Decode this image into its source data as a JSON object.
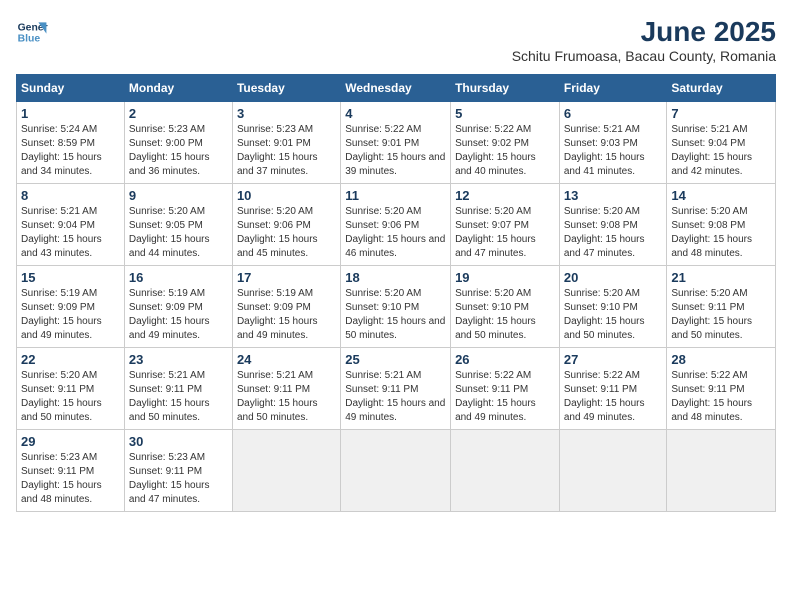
{
  "logo": {
    "line1": "General",
    "line2": "Blue"
  },
  "title": "June 2025",
  "subtitle": "Schitu Frumoasa, Bacau County, Romania",
  "headers": [
    "Sunday",
    "Monday",
    "Tuesday",
    "Wednesday",
    "Thursday",
    "Friday",
    "Saturday"
  ],
  "weeks": [
    [
      {
        "day": "1",
        "sunrise": "5:24 AM",
        "sunset": "8:59 PM",
        "daylight": "15 hours and 34 minutes."
      },
      {
        "day": "2",
        "sunrise": "5:23 AM",
        "sunset": "9:00 PM",
        "daylight": "15 hours and 36 minutes."
      },
      {
        "day": "3",
        "sunrise": "5:23 AM",
        "sunset": "9:01 PM",
        "daylight": "15 hours and 37 minutes."
      },
      {
        "day": "4",
        "sunrise": "5:22 AM",
        "sunset": "9:01 PM",
        "daylight": "15 hours and 39 minutes."
      },
      {
        "day": "5",
        "sunrise": "5:22 AM",
        "sunset": "9:02 PM",
        "daylight": "15 hours and 40 minutes."
      },
      {
        "day": "6",
        "sunrise": "5:21 AM",
        "sunset": "9:03 PM",
        "daylight": "15 hours and 41 minutes."
      },
      {
        "day": "7",
        "sunrise": "5:21 AM",
        "sunset": "9:04 PM",
        "daylight": "15 hours and 42 minutes."
      }
    ],
    [
      {
        "day": "8",
        "sunrise": "5:21 AM",
        "sunset": "9:04 PM",
        "daylight": "15 hours and 43 minutes."
      },
      {
        "day": "9",
        "sunrise": "5:20 AM",
        "sunset": "9:05 PM",
        "daylight": "15 hours and 44 minutes."
      },
      {
        "day": "10",
        "sunrise": "5:20 AM",
        "sunset": "9:06 PM",
        "daylight": "15 hours and 45 minutes."
      },
      {
        "day": "11",
        "sunrise": "5:20 AM",
        "sunset": "9:06 PM",
        "daylight": "15 hours and 46 minutes."
      },
      {
        "day": "12",
        "sunrise": "5:20 AM",
        "sunset": "9:07 PM",
        "daylight": "15 hours and 47 minutes."
      },
      {
        "day": "13",
        "sunrise": "5:20 AM",
        "sunset": "9:08 PM",
        "daylight": "15 hours and 47 minutes."
      },
      {
        "day": "14",
        "sunrise": "5:20 AM",
        "sunset": "9:08 PM",
        "daylight": "15 hours and 48 minutes."
      }
    ],
    [
      {
        "day": "15",
        "sunrise": "5:19 AM",
        "sunset": "9:09 PM",
        "daylight": "15 hours and 49 minutes."
      },
      {
        "day": "16",
        "sunrise": "5:19 AM",
        "sunset": "9:09 PM",
        "daylight": "15 hours and 49 minutes."
      },
      {
        "day": "17",
        "sunrise": "5:19 AM",
        "sunset": "9:09 PM",
        "daylight": "15 hours and 49 minutes."
      },
      {
        "day": "18",
        "sunrise": "5:20 AM",
        "sunset": "9:10 PM",
        "daylight": "15 hours and 50 minutes."
      },
      {
        "day": "19",
        "sunrise": "5:20 AM",
        "sunset": "9:10 PM",
        "daylight": "15 hours and 50 minutes."
      },
      {
        "day": "20",
        "sunrise": "5:20 AM",
        "sunset": "9:10 PM",
        "daylight": "15 hours and 50 minutes."
      },
      {
        "day": "21",
        "sunrise": "5:20 AM",
        "sunset": "9:11 PM",
        "daylight": "15 hours and 50 minutes."
      }
    ],
    [
      {
        "day": "22",
        "sunrise": "5:20 AM",
        "sunset": "9:11 PM",
        "daylight": "15 hours and 50 minutes."
      },
      {
        "day": "23",
        "sunrise": "5:21 AM",
        "sunset": "9:11 PM",
        "daylight": "15 hours and 50 minutes."
      },
      {
        "day": "24",
        "sunrise": "5:21 AM",
        "sunset": "9:11 PM",
        "daylight": "15 hours and 50 minutes."
      },
      {
        "day": "25",
        "sunrise": "5:21 AM",
        "sunset": "9:11 PM",
        "daylight": "15 hours and 49 minutes."
      },
      {
        "day": "26",
        "sunrise": "5:22 AM",
        "sunset": "9:11 PM",
        "daylight": "15 hours and 49 minutes."
      },
      {
        "day": "27",
        "sunrise": "5:22 AM",
        "sunset": "9:11 PM",
        "daylight": "15 hours and 49 minutes."
      },
      {
        "day": "28",
        "sunrise": "5:22 AM",
        "sunset": "9:11 PM",
        "daylight": "15 hours and 48 minutes."
      }
    ],
    [
      {
        "day": "29",
        "sunrise": "5:23 AM",
        "sunset": "9:11 PM",
        "daylight": "15 hours and 48 minutes."
      },
      {
        "day": "30",
        "sunrise": "5:23 AM",
        "sunset": "9:11 PM",
        "daylight": "15 hours and 47 minutes."
      },
      null,
      null,
      null,
      null,
      null
    ]
  ]
}
